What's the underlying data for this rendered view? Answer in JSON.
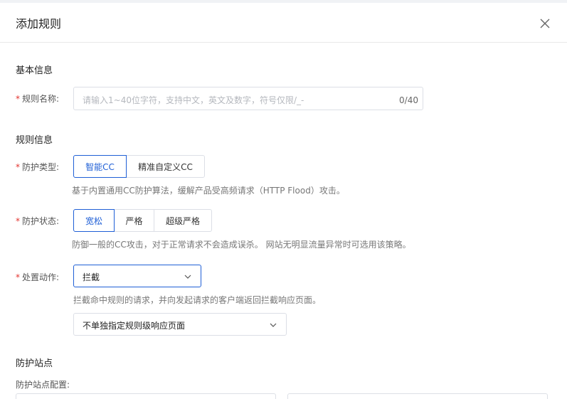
{
  "dialog": {
    "title": "添加规则"
  },
  "basic": {
    "heading": "基本信息",
    "name_label": "规则名称:",
    "name_placeholder": "请输入1~40位字符，支持中文，英文及数字，符号仅限/_-",
    "name_count": "0/40"
  },
  "rule": {
    "heading": "规则信息",
    "type_label": "防护类型:",
    "type_options": [
      "智能CC",
      "精准自定义CC"
    ],
    "type_selected": "智能CC",
    "type_hint": "基于内置通用CC防护算法，缓解产品受高频请求（HTTP Flood）攻击。",
    "status_label": "防护状态:",
    "status_options": [
      "宽松",
      "严格",
      "超级严格"
    ],
    "status_selected": "宽松",
    "status_hint": "防御一般的CC攻击，对于正常请求不会造成误杀。 网站无明显流量异常时可选用该策略。",
    "action_label": "处置动作:",
    "action_value": "拦截",
    "action_hint": "拦截命中规则的请求，并向发起请求的客户端返回拦截响应页面。",
    "page_value": "不单独指定规则级响应页面"
  },
  "site": {
    "heading": "防护站点",
    "config_label": "防护站点配置:"
  },
  "colors": {
    "accent": "#1f5fd6",
    "required": "#e3342f"
  }
}
